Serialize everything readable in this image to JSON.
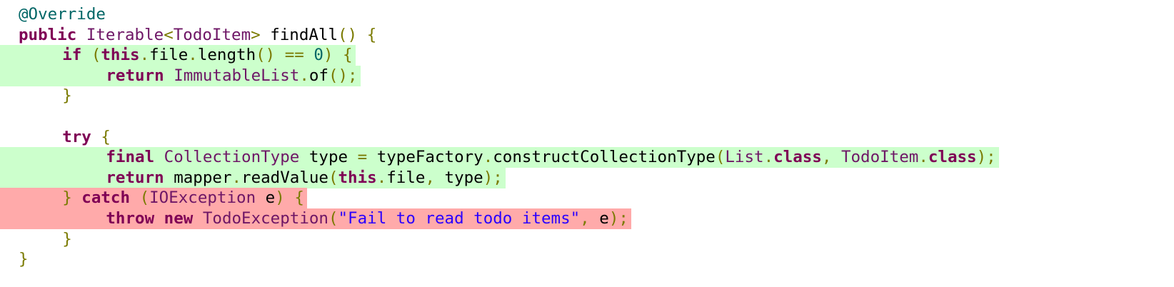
{
  "colors": {
    "keyword": "#7f0055",
    "type": "#6e1666",
    "annotation": "#006666",
    "number": "#006666",
    "string": "#2a00ff",
    "punctuation": "#7a7a00",
    "plain": "#000000",
    "added_background": "#ccffcc",
    "removed_background": "#ffaaaa"
  },
  "lines": [
    {
      "indent": 0,
      "diff": "none",
      "tokens": [
        {
          "t": "@Override",
          "c": "ann"
        }
      ]
    },
    {
      "indent": 0,
      "diff": "none",
      "tokens": [
        {
          "t": "public",
          "c": "kw"
        },
        {
          "t": " ",
          "c": "pl"
        },
        {
          "t": "Iterable",
          "c": "ty"
        },
        {
          "t": "<",
          "c": "punc"
        },
        {
          "t": "TodoItem",
          "c": "ty"
        },
        {
          "t": ">",
          "c": "punc"
        },
        {
          "t": " findAll",
          "c": "pl"
        },
        {
          "t": "()",
          "c": "punc"
        },
        {
          "t": " ",
          "c": "pl"
        },
        {
          "t": "{",
          "c": "punc"
        }
      ]
    },
    {
      "indent": 2,
      "diff": "added",
      "tokens": [
        {
          "t": "if",
          "c": "kw"
        },
        {
          "t": " ",
          "c": "pl"
        },
        {
          "t": "(",
          "c": "punc"
        },
        {
          "t": "this",
          "c": "kw"
        },
        {
          "t": ".",
          "c": "punc"
        },
        {
          "t": "file",
          "c": "pl"
        },
        {
          "t": ".",
          "c": "punc"
        },
        {
          "t": "length",
          "c": "pl"
        },
        {
          "t": "()",
          "c": "punc"
        },
        {
          "t": " ",
          "c": "pl"
        },
        {
          "t": "==",
          "c": "punc"
        },
        {
          "t": " ",
          "c": "pl"
        },
        {
          "t": "0",
          "c": "num"
        },
        {
          "t": ")",
          "c": "punc"
        },
        {
          "t": " ",
          "c": "pl"
        },
        {
          "t": "{",
          "c": "punc"
        }
      ]
    },
    {
      "indent": 4,
      "diff": "added",
      "tokens": [
        {
          "t": "return",
          "c": "kw"
        },
        {
          "t": " ",
          "c": "pl"
        },
        {
          "t": "ImmutableList",
          "c": "ty"
        },
        {
          "t": ".",
          "c": "punc"
        },
        {
          "t": "of",
          "c": "pl"
        },
        {
          "t": "();",
          "c": "punc"
        }
      ]
    },
    {
      "indent": 2,
      "diff": "none",
      "tokens": [
        {
          "t": "}",
          "c": "punc"
        }
      ]
    },
    {
      "indent": 0,
      "diff": "none",
      "tokens": []
    },
    {
      "indent": 2,
      "diff": "none",
      "tokens": [
        {
          "t": "try",
          "c": "kw"
        },
        {
          "t": " ",
          "c": "pl"
        },
        {
          "t": "{",
          "c": "punc"
        }
      ]
    },
    {
      "indent": 4,
      "diff": "added",
      "tokens": [
        {
          "t": "final",
          "c": "kw"
        },
        {
          "t": " ",
          "c": "pl"
        },
        {
          "t": "CollectionType",
          "c": "ty"
        },
        {
          "t": " type ",
          "c": "pl"
        },
        {
          "t": "=",
          "c": "punc"
        },
        {
          "t": " typeFactory",
          "c": "pl"
        },
        {
          "t": ".",
          "c": "punc"
        },
        {
          "t": "constructCollectionType",
          "c": "pl"
        },
        {
          "t": "(",
          "c": "punc"
        },
        {
          "t": "List",
          "c": "ty"
        },
        {
          "t": ".",
          "c": "punc"
        },
        {
          "t": "class",
          "c": "kw"
        },
        {
          "t": ",",
          "c": "punc"
        },
        {
          "t": " ",
          "c": "pl"
        },
        {
          "t": "TodoItem",
          "c": "ty"
        },
        {
          "t": ".",
          "c": "punc"
        },
        {
          "t": "class",
          "c": "kw"
        },
        {
          "t": ");",
          "c": "punc"
        }
      ]
    },
    {
      "indent": 4,
      "diff": "added",
      "tokens": [
        {
          "t": "return",
          "c": "kw"
        },
        {
          "t": " mapper",
          "c": "pl"
        },
        {
          "t": ".",
          "c": "punc"
        },
        {
          "t": "readValue",
          "c": "pl"
        },
        {
          "t": "(",
          "c": "punc"
        },
        {
          "t": "this",
          "c": "kw"
        },
        {
          "t": ".",
          "c": "punc"
        },
        {
          "t": "file",
          "c": "pl"
        },
        {
          "t": ",",
          "c": "punc"
        },
        {
          "t": " type",
          "c": "pl"
        },
        {
          "t": ");",
          "c": "punc"
        }
      ]
    },
    {
      "indent": 2,
      "diff": "removed",
      "tokens": [
        {
          "t": "}",
          "c": "punc"
        },
        {
          "t": " ",
          "c": "pl"
        },
        {
          "t": "catch",
          "c": "kw"
        },
        {
          "t": " ",
          "c": "pl"
        },
        {
          "t": "(",
          "c": "punc"
        },
        {
          "t": "IOException",
          "c": "ty"
        },
        {
          "t": " e",
          "c": "pl"
        },
        {
          "t": ")",
          "c": "punc"
        },
        {
          "t": " ",
          "c": "pl"
        },
        {
          "t": "{",
          "c": "punc"
        }
      ]
    },
    {
      "indent": 4,
      "diff": "removed",
      "tokens": [
        {
          "t": "throw",
          "c": "kw"
        },
        {
          "t": " ",
          "c": "pl"
        },
        {
          "t": "new",
          "c": "kw"
        },
        {
          "t": " ",
          "c": "pl"
        },
        {
          "t": "TodoException",
          "c": "ty"
        },
        {
          "t": "(",
          "c": "punc"
        },
        {
          "t": "\"Fail to read todo items\"",
          "c": "str"
        },
        {
          "t": ",",
          "c": "punc"
        },
        {
          "t": " e",
          "c": "pl"
        },
        {
          "t": ");",
          "c": "punc"
        }
      ]
    },
    {
      "indent": 2,
      "diff": "none",
      "tokens": [
        {
          "t": "}",
          "c": "punc"
        }
      ]
    },
    {
      "indent": 0,
      "diff": "none",
      "tokens": [
        {
          "t": "}",
          "c": "punc"
        }
      ]
    }
  ]
}
